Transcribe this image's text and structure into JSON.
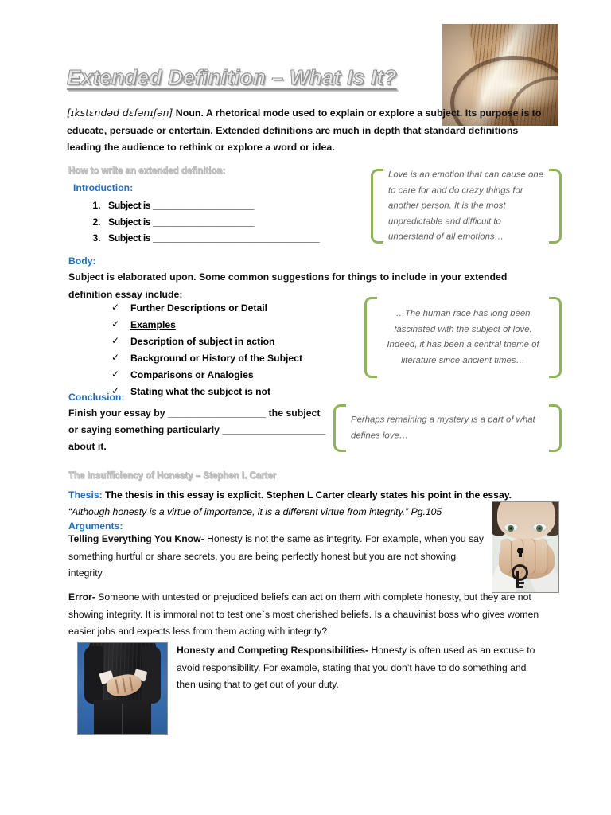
{
  "document": {
    "title": "Extended Definition – What Is It?",
    "definition": {
      "ipa": "[ɪkstɛndəd dɛfənɪʃən]",
      "text": " Noun.  A rhetorical mode used to explain or explore a subject. Its purpose is to educate, persuade or entertain.  Extended definitions are much in depth that standard definitions leading the audience to rethink or explore a word or idea."
    },
    "how_to_heading": "How to write an extended definition:",
    "introduction": {
      "heading": "Introduction:",
      "items": [
        "Subject is ____________________",
        "Subject is ____________________",
        "Subject is _________________________________"
      ]
    },
    "body": {
      "heading": "Body:",
      "intro": " Subject is elaborated upon. Some common suggestions for things to include in your extended definition essay include:",
      "checklist": [
        {
          "label": "Further Descriptions or Detail",
          "underlined": false
        },
        {
          "label": "Examples",
          "underlined": true
        },
        {
          "label": "Description of subject in action",
          "underlined": false
        },
        {
          "label": "Background or History of the Subject",
          "underlined": false
        },
        {
          "label": "Comparisons or Analogies",
          "underlined": false
        },
        {
          "label": "Stating what the subject is not",
          "underlined": false
        }
      ]
    },
    "conclusion": {
      "heading": "Conclusion:",
      "line1": " Finish your essay by __________________ the subject",
      "line2": "or saying something particularly ___________________",
      "line3": "about it."
    },
    "quotes": [
      {
        "name": "love-definition-quote",
        "text": "Love is an emotion that can cause one to care for and do crazy things for another person. It is the most unpredictable and difficult to understand of all emotions…",
        "align": "left"
      },
      {
        "name": "human-race-quote",
        "text": "…The human race has long been fascinated with the subject of love. Indeed, it has been a central theme of literature since ancient times…",
        "align": "center"
      },
      {
        "name": "mystery-quote",
        "text": "Perhaps remaining a mystery is a part of what defines love…",
        "align": "left"
      }
    ],
    "essay": {
      "heading": "The Insufficiency of Honesty – Stephen I. Carter",
      "thesis_label": "Thesis:",
      "thesis_text": " The thesis in this essay is explicit. Stephen L Carter clearly states his point in the essay.",
      "thesis_quote": "“Although honesty is a virtue of importance, it is a different virtue from integrity.” Pg.105",
      "arguments_label": "Arguments:",
      "arguments": [
        {
          "name": "telling-everything-you-know",
          "lead": "Telling Everything You Know-",
          "text": " Honesty is not the same as integrity. For example, when you say something hurtful or share secrets, you are being perfectly honest but you are not showing integrity."
        },
        {
          "name": "error",
          "lead": "Error-",
          "text": " Someone with untested or prejudiced beliefs can act on them with complete honesty, but they are not showing integrity. It is immoral not to test one`s most cherished beliefs. Is a chauvinist boss who gives women easier jobs and expects less from them acting with integrity?"
        },
        {
          "name": "honesty-and-competing-responsibilities",
          "lead": "Honesty and Competing Responsibilities-",
          "text": " Honesty is often used as an excuse to avoid responsibility. For example, stating that you don’t have to do something and then using that to get out of your duty."
        }
      ]
    },
    "images": [
      {
        "name": "book-and-glasses-photo",
        "alt": "Reading glasses resting on an open dictionary page, sepia toned"
      },
      {
        "name": "hand-over-mouth-photo",
        "alt": "Person covering mouth with hand, keyhole and key drawn on the hand"
      },
      {
        "name": "man-in-suit-crossed-fingers-photo",
        "alt": "Man in a dark pinstripe suit with hands crossed behind his back"
      }
    ],
    "colors": {
      "heading_blue": "#1f6fc0",
      "bracket_green": "#8fb457",
      "wordart_silver": "#cfcfcf",
      "quote_text_gray": "#5e5e5e"
    }
  }
}
